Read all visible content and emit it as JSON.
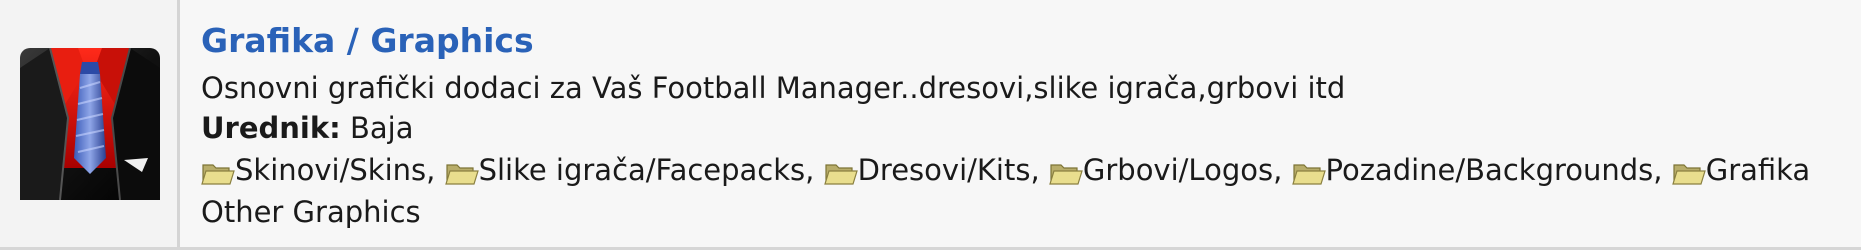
{
  "forum": {
    "title": "Grafika / Graphics",
    "description": "Osnovni grafički dodaci za Vaš Football Manager..dresovi,slike igrača,grbovi itd",
    "moderator_label": "Urednik:",
    "moderator_name": "Baja",
    "icon": "suit-and-tie-icon",
    "subforums": [
      {
        "label": "Skinovi/Skins",
        "icon": "folder-icon"
      },
      {
        "label": "Slike igrača/Facepacks",
        "icon": "folder-icon"
      },
      {
        "label": "Dresovi/Kits",
        "icon": "folder-icon"
      },
      {
        "label": "Grbovi/Logos",
        "icon": "folder-icon"
      },
      {
        "label": "Pozadine/Backgrounds",
        "icon": "folder-icon"
      },
      {
        "label": "Grafika",
        "icon": "folder-icon"
      }
    ],
    "subforums_wrap": "Other Graphics",
    "separator": ", "
  },
  "colors": {
    "title": "#2a62b8",
    "text": "#1a1a1a",
    "row_background": "#f7f7f7"
  }
}
